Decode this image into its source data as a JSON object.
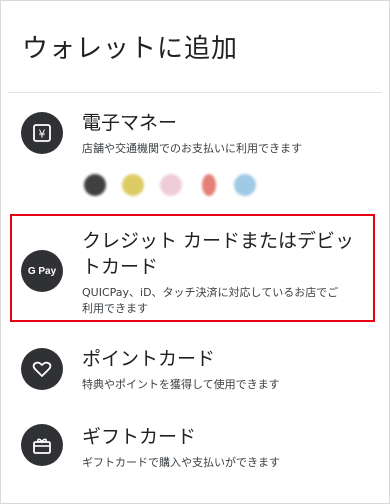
{
  "page": {
    "title": "ウォレットに追加"
  },
  "items": [
    {
      "title": "電子マネー",
      "description": "店舗や交通機関でのお支払いに利用できます",
      "icon": "yen-card-icon"
    },
    {
      "title_line1": "クレジット カードまたはデビッ",
      "title_line2": "トカード",
      "description_line1": "QUICPay、iD、タッチ決済に対応しているお店でご",
      "description_line2": "利用できます",
      "icon": "gpay-icon",
      "icon_text": "G Pay"
    },
    {
      "title": "ポイントカード",
      "description": "特典やポイントを獲得して使用できます",
      "icon": "heart-tag-icon"
    },
    {
      "title": "ギフトカード",
      "description": "ギフトカードで購入や支払いができます",
      "icon": "gift-card-icon"
    }
  ],
  "colors": {
    "highlight": "#e60012",
    "icon_bg": "#303134",
    "brand_logos": [
      "#222222",
      "#d8c34a",
      "#e8b9c9",
      "#d9534f",
      "#7fb3d8"
    ]
  }
}
